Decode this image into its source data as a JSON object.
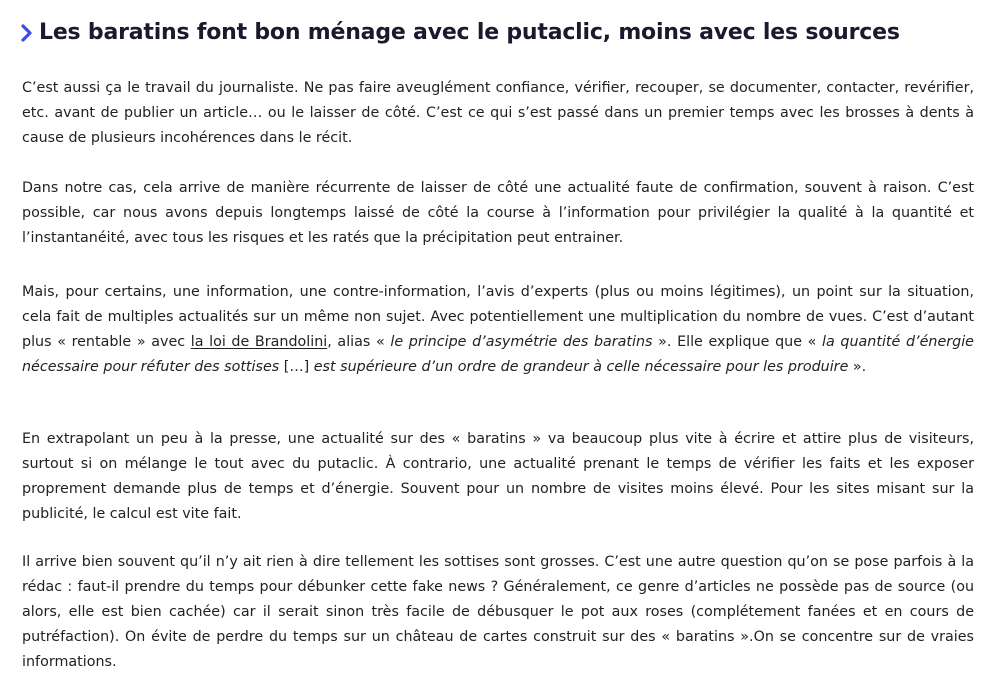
{
  "heading": {
    "icon": "chevron-right-icon",
    "icon_color": "#3a4fe0",
    "text": "Les baratins font bon ménage avec le putaclic, moins avec les sources"
  },
  "paragraphs": {
    "p1": "C’est aussi ça le travail du journaliste. Ne pas faire aveuglément confiance, vérifier, recouper, se documenter, contacter, revérifier, etc. avant de publier un article… ou le laisser de côté. C’est ce qui s’est passé dans un premier temps avec les brosses à dents à cause de plusieurs incohérences dans le récit.",
    "p2": "Dans notre cas, cela arrive de manière récurrente de laisser de côté une actualité faute de confirmation, souvent à raison. C’est possible, car nous avons depuis longtemps laissé de côté la course à l’information pour privilégier la qualité à la quantité et l’instantanéité, avec tous les risques et les ratés que la précipitation peut entrainer.",
    "p3": {
      "t1": "Mais, pour certains, une information, une contre-information, l’avis d’experts (plus ou moins légitimes), un point sur la situation, cela fait de multiples actualités sur un même non sujet. Avec potentiellement une multiplication du nombre de vues. C’est d’autant plus « rentable » avec ",
      "link": "la loi de Brandolini",
      "t2": ", alias « ",
      "i1": "le principe d’asymétrie des baratins",
      "t3": " ». Elle explique que « ",
      "i2": "la quantité d’énergie nécessaire pour réfuter des sottises",
      "t4": " […] ",
      "i3": "est supérieure d’un ordre de grandeur à celle nécessaire pour les produire",
      "t5": " »."
    },
    "p4": "En extrapolant un peu à la presse, une actualité sur des « baratins » va beaucoup plus vite à écrire et attire plus de visiteurs, surtout si on mélange le tout avec du putaclic. À contrario, une actualité prenant le temps de vérifier les faits et les exposer proprement demande plus de temps et d’énergie. Souvent pour un nombre de visites moins élevé. Pour les sites misant sur la publicité, le calcul est vite fait.",
    "p5": "Il arrive bien souvent qu’il n’y ait rien à dire tellement les sottises sont grosses. C’est une autre question qu’on se pose parfois à la rédac : faut-il prendre du temps pour débunker cette fake news ? Généralement, ce genre d’articles ne possède pas de source (ou alors, elle est bien cachée) car il serait sinon très facile de débusquer le pot aux roses (complétement fanées et en cours de putréfaction). On évite de perdre du temps sur un château de cartes construit sur des « baratins ».On se concentre sur de vraies informations."
  }
}
